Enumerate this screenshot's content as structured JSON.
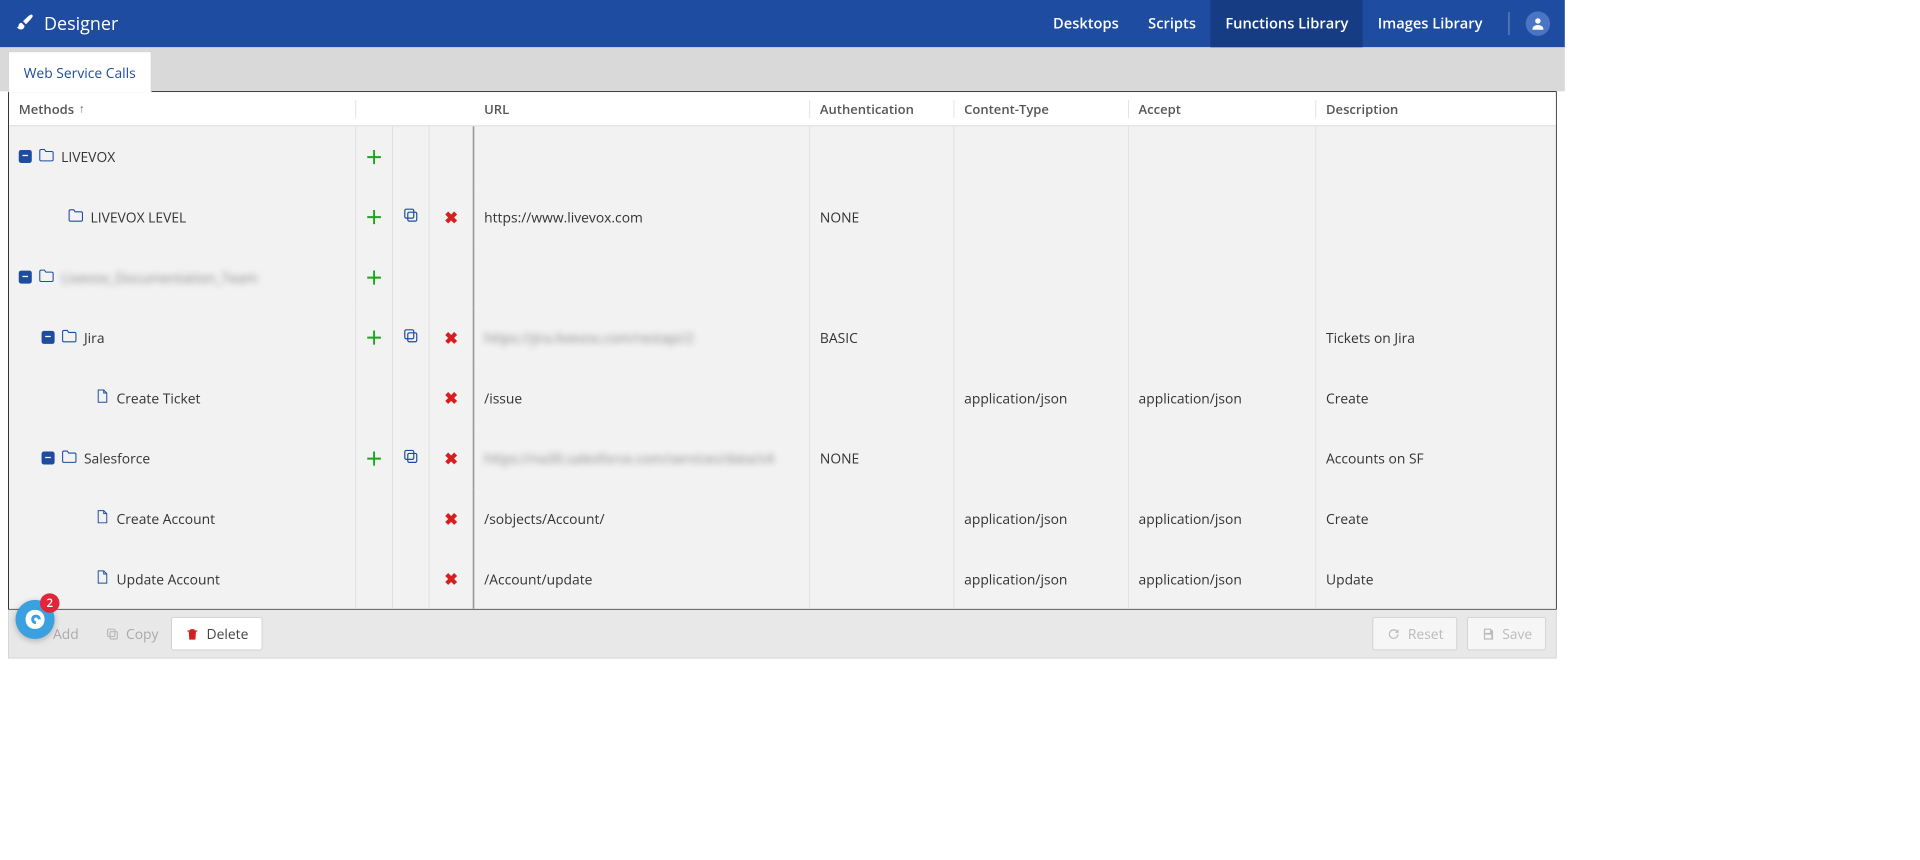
{
  "header": {
    "app_title": "Designer",
    "nav": {
      "desktops": "Desktops",
      "scripts": "Scripts",
      "functions": "Functions Library",
      "images": "Images Library"
    }
  },
  "tab": {
    "web_service_calls": "Web Service Calls"
  },
  "table": {
    "headers": {
      "methods": "Methods",
      "url": "URL",
      "auth": "Authentication",
      "ct": "Content-Type",
      "accept": "Accept",
      "desc": "Description"
    },
    "rows": [
      {
        "kind": "group",
        "indent": 0,
        "toggle": "−",
        "label": "LIVEVOX",
        "add": true,
        "url": "",
        "auth": "",
        "ct": "",
        "accept": "",
        "desc": ""
      },
      {
        "kind": "sub",
        "indent": 1,
        "label": "LIVEVOX LEVEL",
        "add": true,
        "copy": true,
        "del": true,
        "url": "https://www.livevox.com",
        "auth": "NONE",
        "ct": "",
        "accept": "",
        "desc": ""
      },
      {
        "kind": "group",
        "indent": 0,
        "toggle": "−",
        "label": "Livevox_Documentation_Team",
        "blurLabel": true,
        "add": true,
        "url": "",
        "auth": "",
        "ct": "",
        "accept": "",
        "desc": ""
      },
      {
        "kind": "group",
        "indent": 1,
        "toggle": "−",
        "label": "Jira",
        "add": true,
        "copy": true,
        "del": true,
        "url": "https://jira.livevox.com/restapi/2",
        "blurUrl": true,
        "auth": "BASIC",
        "ct": "",
        "accept": "",
        "desc": "Tickets on Jira"
      },
      {
        "kind": "leaf",
        "indent": 2,
        "label": "Create Ticket",
        "del": true,
        "url": "/issue",
        "auth": "",
        "ct": "application/json",
        "accept": "application/json",
        "desc": "Create"
      },
      {
        "kind": "group",
        "indent": 1,
        "toggle": "−",
        "label": "Salesforce",
        "add": true,
        "copy": true,
        "del": true,
        "url": "https://na30.salesforce.com/services/data/v4",
        "blurUrl": true,
        "auth": "NONE",
        "ct": "",
        "accept": "",
        "desc": "Accounts on SF"
      },
      {
        "kind": "leaf",
        "indent": 2,
        "label": "Create Account",
        "del": true,
        "url": "/sobjects/Account/",
        "auth": "",
        "ct": "application/json",
        "accept": "application/json",
        "desc": "Create"
      },
      {
        "kind": "leaf",
        "indent": 2,
        "label": "Update Account",
        "del": true,
        "url": "/Account/update",
        "auth": "",
        "ct": "application/json",
        "accept": "application/json",
        "desc": "Update"
      }
    ]
  },
  "footer": {
    "add": "Add",
    "copy": "Copy",
    "delete": "Delete",
    "reset": "Reset",
    "save": "Save",
    "badge": "2"
  }
}
